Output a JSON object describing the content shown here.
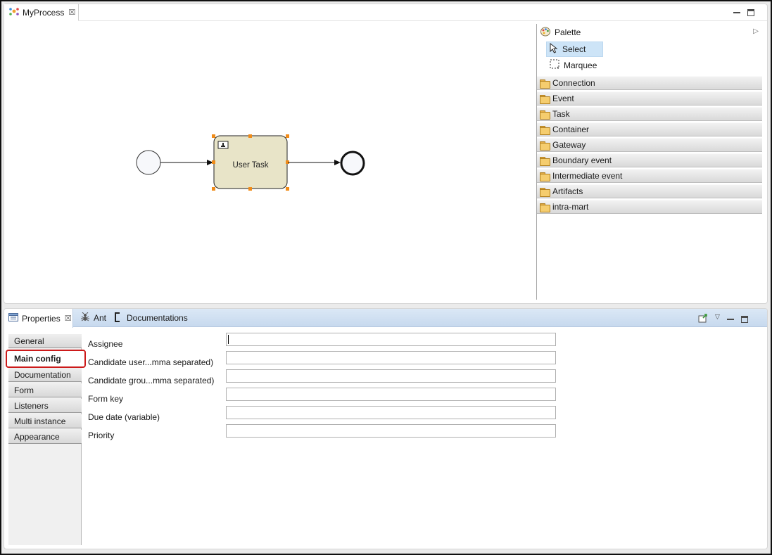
{
  "editor": {
    "tab_title": "MyProcess",
    "close_glyph": "☒",
    "diagram": {
      "task_label": "User Task",
      "task_icon": "user-task-icon"
    }
  },
  "palette": {
    "title": "Palette",
    "tools": [
      {
        "label": "Select",
        "icon": "cursor-arrow-icon",
        "selected": true
      },
      {
        "label": "Marquee",
        "icon": "marquee-icon",
        "selected": false
      }
    ],
    "drawers": [
      {
        "label": "Connection"
      },
      {
        "label": "Event"
      },
      {
        "label": "Task"
      },
      {
        "label": "Container"
      },
      {
        "label": "Gateway"
      },
      {
        "label": "Boundary event"
      },
      {
        "label": "Intermediate event"
      },
      {
        "label": "Artifacts"
      },
      {
        "label": "intra-mart"
      }
    ]
  },
  "properties": {
    "tabs": [
      {
        "label": "Properties",
        "icon": "properties-icon",
        "active": true
      },
      {
        "label": "Ant",
        "icon": "ant-icon",
        "active": false
      },
      {
        "label": "Documentations",
        "icon": "documentations-icon",
        "active": false
      }
    ],
    "side_tabs": [
      {
        "label": "General"
      },
      {
        "label": "Main config"
      },
      {
        "label": "Documentation"
      },
      {
        "label": "Form"
      },
      {
        "label": "Listeners"
      },
      {
        "label": "Multi instance"
      },
      {
        "label": "Appearance"
      }
    ],
    "active_side_tab": "Main config",
    "fields": [
      {
        "label": "Assignee",
        "value": ""
      },
      {
        "label": "Candidate user...mma separated)",
        "value": ""
      },
      {
        "label": "Candidate grou...mma separated)",
        "value": ""
      },
      {
        "label": "Form key",
        "value": ""
      },
      {
        "label": "Due date (variable)",
        "value": ""
      },
      {
        "label": "Priority",
        "value": ""
      }
    ]
  },
  "colors": {
    "task_fill": "#e8e4c8",
    "selection_handle": "#f08c1a",
    "highlight_border": "#cc1a1a",
    "select_tool_bg": "#cde4f7"
  }
}
